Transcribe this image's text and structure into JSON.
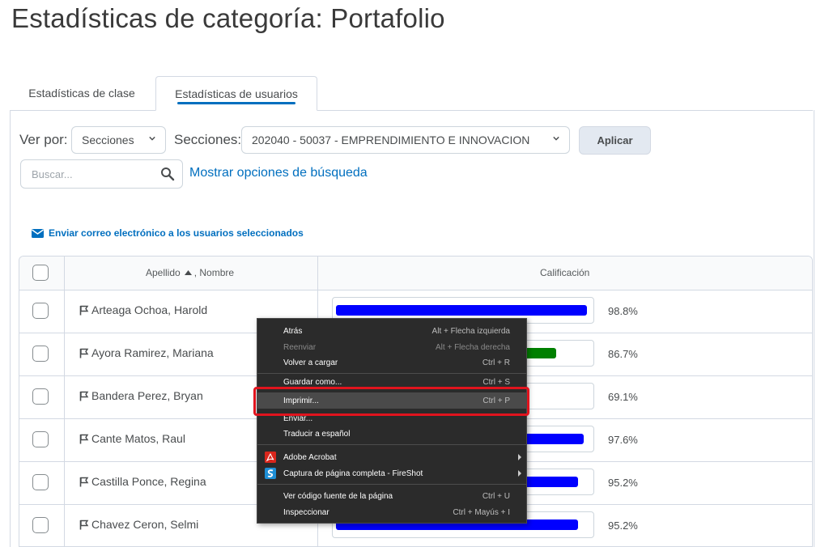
{
  "page": {
    "title": "Estadísticas de categoría: Portafolio"
  },
  "tabs": [
    {
      "label": "Estadísticas de clase",
      "active": false
    },
    {
      "label": "Estadísticas de usuarios",
      "active": true
    }
  ],
  "filters": {
    "view_by_label": "Ver por:",
    "view_by_value": "Secciones",
    "sections_label": "Secciones:",
    "sections_value": "202040 - 50037 - EMPRENDIMIENTO E INNOVACION",
    "apply_label": "Aplicar"
  },
  "search": {
    "placeholder": "Buscar...",
    "advanced_link": "Mostrar opciones de búsqueda"
  },
  "email_link": "Enviar correo electrónico a los usuarios seleccionados",
  "table": {
    "col_name_header_last": "Apellido",
    "col_name_header_first": ", Nombre",
    "col_grade_header": "Calificación",
    "rows": [
      {
        "name": "Arteaga Ochoa, Harold",
        "grade": "98.8%",
        "fraction": 0.988,
        "color": "#0000ff"
      },
      {
        "name": "Ayora Ramirez, Mariana",
        "grade": "86.7%",
        "fraction": 0.867,
        "color": "#008000"
      },
      {
        "name": "Bandera Perez, Bryan",
        "grade": "69.1%",
        "fraction": 0.691,
        "color": "#ffa500"
      },
      {
        "name": "Cante Matos, Raul",
        "grade": "97.6%",
        "fraction": 0.976,
        "color": "#0000ff"
      },
      {
        "name": "Castilla Ponce, Regina",
        "grade": "95.2%",
        "fraction": 0.952,
        "color": "#0000ff"
      },
      {
        "name": "Chavez Ceron, Selmi",
        "grade": "95.2%",
        "fraction": 0.952,
        "color": "#0000ff"
      }
    ]
  },
  "context_menu": {
    "items": [
      {
        "label": "Atrás",
        "shortcut": "Alt + Flecha izquierda",
        "disabled": false
      },
      {
        "label": "Reenviar",
        "shortcut": "Alt + Flecha derecha",
        "disabled": true
      },
      {
        "label": "Volver a cargar",
        "shortcut": "Ctrl + R",
        "disabled": false
      },
      {
        "label": "Guardar como...",
        "shortcut": "Ctrl + S",
        "disabled": false
      },
      {
        "label": "Imprimir...",
        "shortcut": "Ctrl + P",
        "disabled": false
      },
      {
        "label": "Enviar...",
        "shortcut": "",
        "disabled": false
      },
      {
        "label": "Traducir a español",
        "shortcut": "",
        "disabled": false
      },
      {
        "label": "Adobe Acrobat",
        "shortcut": "",
        "disabled": false,
        "icon": "adobe-acrobat-icon"
      },
      {
        "label": "Captura de página completa - FireShot",
        "shortcut": "",
        "disabled": false,
        "icon": "fireshot-icon"
      },
      {
        "label": "Ver código fuente de la página",
        "shortcut": "Ctrl + U",
        "disabled": false
      },
      {
        "label": "Inspeccionar",
        "shortcut": "Ctrl + Mayús + I",
        "disabled": false
      }
    ],
    "highlighted": "Imprimir..."
  },
  "colors": {
    "accent": "#006fbf",
    "highlight_box": "#e1141e"
  }
}
